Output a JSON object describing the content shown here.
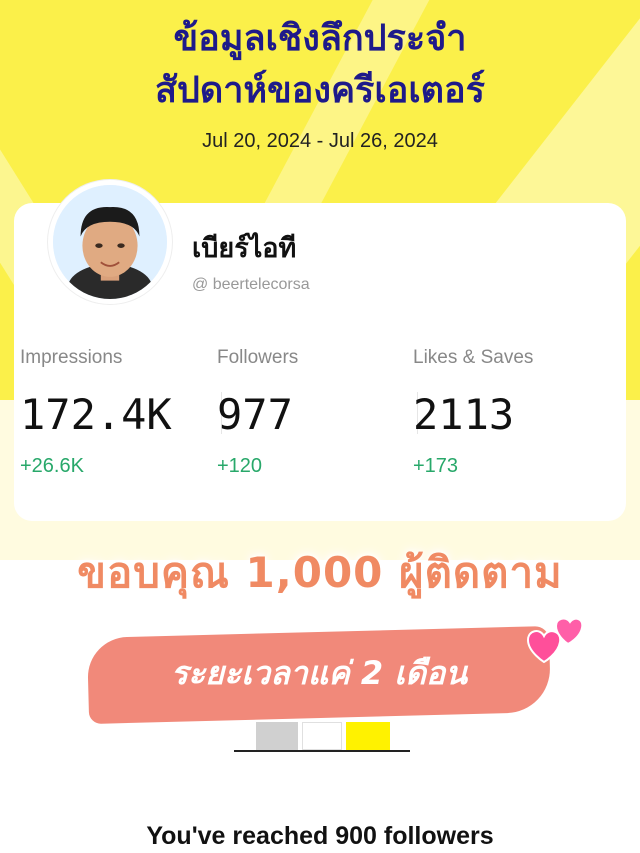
{
  "header": {
    "title_line1": "ข้อมูลเชิงลึกประจำ",
    "title_line2": "สัปดาห์ของครีเอเตอร์",
    "date_range": "Jul 20, 2024 - Jul 26, 2024"
  },
  "profile": {
    "name": "เบียร์ไอที",
    "handle": "@ beertelecorsa"
  },
  "stats": [
    {
      "label": "Impressions",
      "value": "172.4K",
      "delta": "+26.6K"
    },
    {
      "label": "Followers",
      "value": "977",
      "delta": "+120"
    },
    {
      "label": "Likes & Saves",
      "value": "2113",
      "delta": "+173"
    }
  ],
  "overlay": {
    "thanks_text": "ขอบคุณ 1,000 ผู้ติดตาม",
    "duration_text": "ระยะเวลาแค่ 2 เดือน"
  },
  "milestone": {
    "text": "You've reached 900 followers"
  },
  "colors": {
    "background_yellow": "#fbf04a",
    "title_navy": "#1e1a8a",
    "delta_green": "#28a86a",
    "accent_coral": "#f1897a"
  }
}
